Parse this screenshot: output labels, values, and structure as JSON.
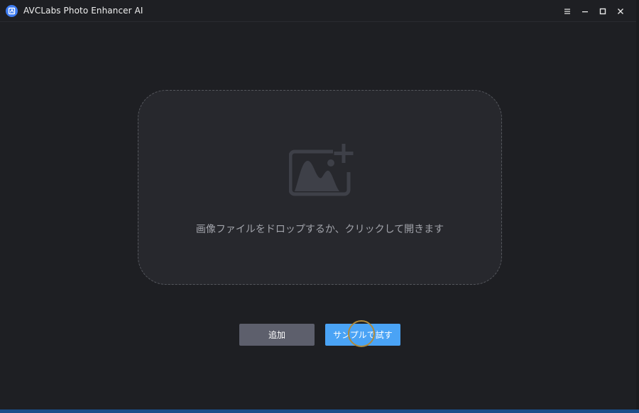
{
  "app": {
    "title": "AVCLabs Photo Enhancer AI",
    "logo_icon": "avclabs-logo-icon"
  },
  "window_controls": {
    "menu_icon": "hamburger-menu-icon",
    "minimize_icon": "minimize-icon",
    "maximize_icon": "maximize-icon",
    "close_icon": "close-icon"
  },
  "dropzone": {
    "icon": "add-image-icon",
    "text": "画像ファイルをドロップするか、クリックして開きます"
  },
  "actions": {
    "add_label": "追加",
    "sample_label": "サンプルで試す"
  },
  "colors": {
    "background": "#1e1f23",
    "dropzone_bg": "#27282d",
    "add_button": "#5d5f6c",
    "primary_button": "#4aa3f5",
    "logo": "#3d7bf0"
  }
}
